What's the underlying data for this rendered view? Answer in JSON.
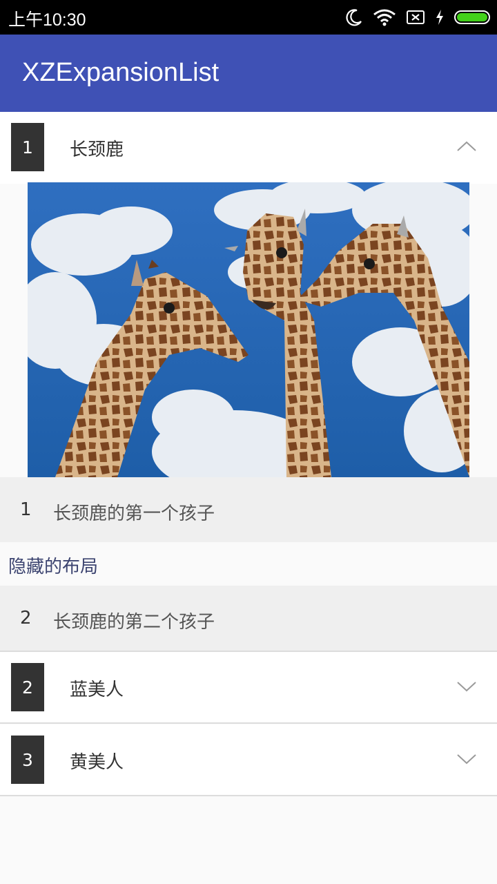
{
  "status_bar": {
    "time": "上午10:30",
    "icons": [
      "moon-icon",
      "wifi-icon",
      "no-sim-icon",
      "charging-icon",
      "battery-icon"
    ],
    "battery_color": "#43d11a"
  },
  "toolbar": {
    "title": "XZExpansionList",
    "background": "#3f51b5"
  },
  "groups": [
    {
      "number": "1",
      "label": "长颈鹿",
      "expanded": true,
      "icon": "chevron-up-icon",
      "image": "three-giraffes-against-cloudy-blue-sky",
      "children": [
        {
          "number": "1",
          "label": "长颈鹿的第一个孩子",
          "expanded": true,
          "hidden_text": "隐藏的布局"
        },
        {
          "number": "2",
          "label": "长颈鹿的第二个孩子",
          "expanded": false
        }
      ]
    },
    {
      "number": "2",
      "label": "蓝美人",
      "expanded": false,
      "icon": "chevron-down-icon"
    },
    {
      "number": "3",
      "label": "黄美人",
      "expanded": false,
      "icon": "chevron-down-icon"
    }
  ]
}
